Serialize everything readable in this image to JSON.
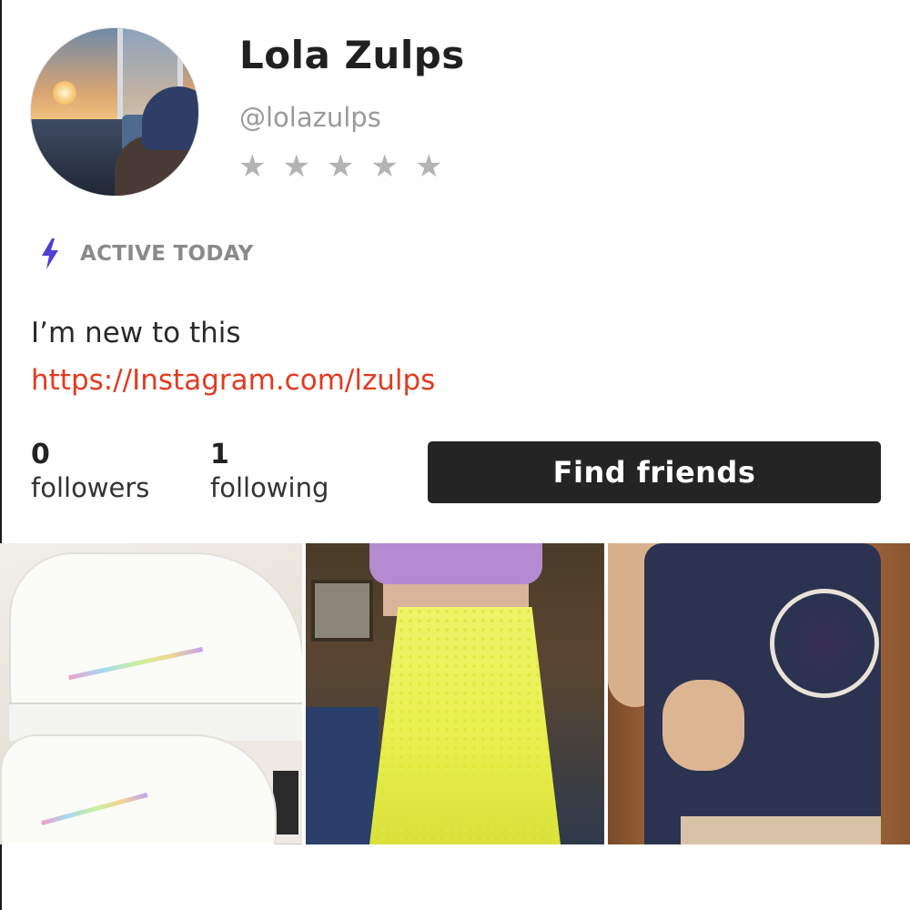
{
  "profile": {
    "name": "Lola Zulps",
    "handle": "@lolazulps",
    "rating": {
      "value": 0,
      "max": 5,
      "icon": "star-icon",
      "empty_color": "#b3b3b3"
    },
    "activity": {
      "icon": "lightning-bolt-icon",
      "label": "ACTIVE TODAY",
      "icon_color": "#4b3fd6"
    },
    "bio": "I’m new to this",
    "link": {
      "text": "https://Instagram.com/lzulps",
      "color": "#e23b20"
    }
  },
  "stats": {
    "followers": {
      "count": "0",
      "label": "followers"
    },
    "following": {
      "count": "1",
      "label": "following"
    }
  },
  "actions": {
    "find_friends_label": "Find friends"
  },
  "photos": [
    {
      "name": "listing-photo-sneakers"
    },
    {
      "name": "listing-photo-yellow-skirt"
    },
    {
      "name": "listing-photo-navy-tee"
    }
  ],
  "colors": {
    "button_bg": "#242424",
    "text_primary": "#202020",
    "text_muted": "#9a9a9a"
  }
}
